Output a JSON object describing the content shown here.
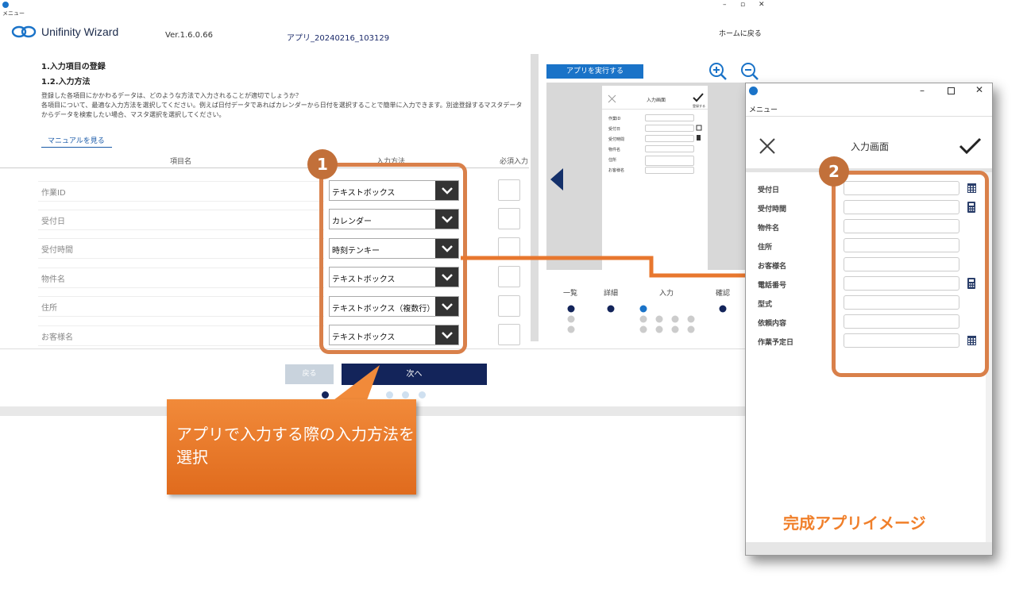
{
  "window": {
    "menu": "メニュー",
    "controls": [
      "–",
      "▫",
      "✕"
    ]
  },
  "header": {
    "logo": "Unifinity Wizard",
    "version": "Ver.1.6.0.66",
    "app_name": "アプリ_20240216_103129",
    "home_link": "ホームに戻る"
  },
  "content": {
    "step_title": "1.入力項目の登録",
    "sub_title": "1.2.入力方法",
    "description": "登録した各項目にかかわるデータは、どのような方法で入力されることが適切でしょうか？\n各項目について、最適な入力方法を選択してください。例えば日付データであればカレンダーから日付を選択することで簡単に入力できます。別途登録するマスタデータからデータを検索したい場合、マスタ選択を選択してください。",
    "manual_link": "マニュアルを見る",
    "columns": {
      "name": "項目名",
      "method": "入力方法",
      "required": "必須入力"
    },
    "rows": [
      {
        "name": "作業ID",
        "method": "テキストボックス"
      },
      {
        "name": "受付日",
        "method": "カレンダー"
      },
      {
        "name": "受付時間",
        "method": "時刻テンキー"
      },
      {
        "name": "物件名",
        "method": "テキストボックス"
      },
      {
        "name": "住所",
        "method": "テキストボックス（複数行）"
      },
      {
        "name": "お客様名",
        "method": "テキストボックス"
      }
    ]
  },
  "footer": {
    "back": "戻る",
    "next": "次へ"
  },
  "preview": {
    "run_button": "アプリを実行する",
    "phone_title": "入力画面",
    "phone_check_label": "登録する",
    "phone_fields": [
      "作業ID",
      "受付日",
      "受付時間",
      "物件名",
      "住所",
      "お客様名"
    ],
    "steps": [
      "一覧",
      "詳細",
      "入力",
      "確認"
    ]
  },
  "app_window": {
    "menu": "メニュー",
    "screen_title": "入力画面",
    "fields": [
      "受付日",
      "受付時間",
      "物件名",
      "住所",
      "お客様名",
      "電話番号",
      "型式",
      "依頼内容",
      "作業予定日"
    ]
  },
  "annotations": {
    "badge1": "1",
    "badge2": "2",
    "callout": "アプリで入力する際の入力方法を選択",
    "completed": "完成アプリイメージ"
  },
  "colors": {
    "accent": "#1a73c8",
    "navy": "#13245a",
    "orange": "#e8772e"
  }
}
